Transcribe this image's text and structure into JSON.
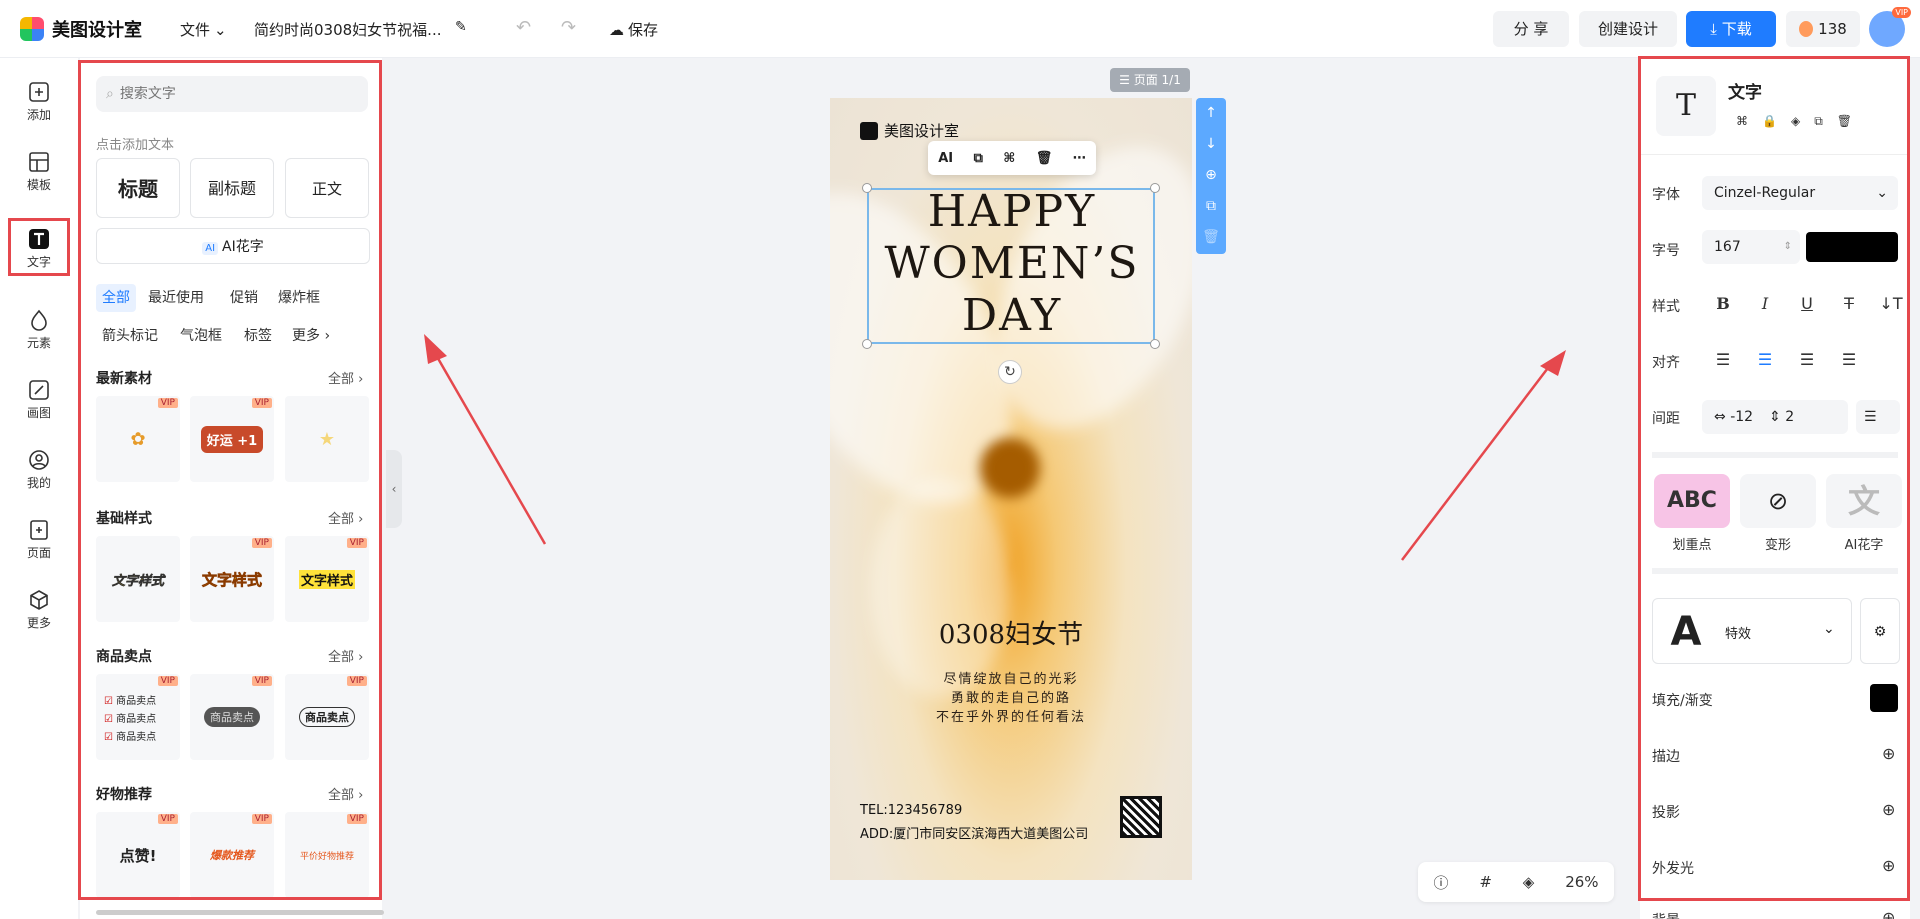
{
  "topbar": {
    "app_name": "美图设计室",
    "menu_file": "文件",
    "doc_title": "简约时尚0308妇女节祝福...",
    "save": "保存",
    "share": "分 享",
    "create": "创建设计",
    "download": "下载",
    "coins": "138",
    "vip": "VIP"
  },
  "rail": {
    "items": [
      {
        "label": "添加",
        "icon": "plus-square-icon"
      },
      {
        "label": "模板",
        "icon": "template-icon"
      },
      {
        "label": "文字",
        "icon": "text-icon"
      },
      {
        "label": "元素",
        "icon": "shapes-icon"
      },
      {
        "label": "画图",
        "icon": "draw-icon"
      },
      {
        "label": "我的",
        "icon": "user-icon"
      },
      {
        "label": "页面",
        "icon": "page-add-icon"
      },
      {
        "label": "更多",
        "icon": "cube-icon"
      }
    ],
    "active": "文字"
  },
  "panel": {
    "search_placeholder": "搜索文字",
    "hint": "点击添加文本",
    "btn_title": "标题",
    "btn_subtitle": "副标题",
    "btn_body": "正文",
    "ai_badge": "AI",
    "ai_btn": "AI花字",
    "tags": [
      "全部",
      "最近使用",
      "促销",
      "爆炸框",
      "箭头标记",
      "气泡框",
      "标签",
      "更多"
    ],
    "all_label": "全部",
    "sections": [
      {
        "title": "最新素材",
        "cards": [
          {
            "text": "",
            "vip": true
          },
          {
            "text": "好运 +1",
            "vip": true
          },
          {
            "text": "",
            "vip": false
          }
        ]
      },
      {
        "title": "基础样式",
        "cards": [
          {
            "text": "文字样式",
            "vip": false
          },
          {
            "text": "文字样式",
            "vip": true
          },
          {
            "text": "文字样式",
            "vip": true
          }
        ]
      },
      {
        "title": "商品卖点",
        "cards": [
          {
            "text": "商品卖点",
            "vip": true
          },
          {
            "text": "商品卖点",
            "vip": true
          },
          {
            "text": "商品卖点",
            "vip": true
          }
        ]
      },
      {
        "title": "好物推荐",
        "cards": [
          {
            "text": "点赞!",
            "vip": true
          },
          {
            "text": "爆款推荐",
            "vip": true
          },
          {
            "text": "平价好物推荐",
            "vip": true
          }
        ]
      }
    ],
    "vip_label": "VIP"
  },
  "canvas": {
    "page_label": "页面 1/1",
    "brand": "美图设计室",
    "headline": [
      "HAPPY",
      "WOMEN’S",
      "DAY"
    ],
    "title": "0308妇女节",
    "lines": [
      "尽情绽放自己的光彩",
      "勇敢的走自己的路",
      "不在乎外界的任何看法"
    ],
    "tel": "TEL:123456789",
    "addr": "ADD:厦门市同安区滨海西大道美图公司",
    "floatbar_ai": "AI"
  },
  "bottom": {
    "zoom": "26%"
  },
  "right": {
    "header": "文字",
    "font_label": "字体",
    "font_value": "Cinzel-Regular",
    "size_label": "字号",
    "size_value": "167",
    "style_label": "样式",
    "align_label": "对齐",
    "spacing_label": "间距",
    "letter_spacing": "-12",
    "line_spacing": "2",
    "fx": [
      "划重点",
      "变形",
      "AI花字"
    ],
    "fx_abc": "ABC",
    "fx_wen": "文",
    "effect_label": "特效",
    "effect_glyph": "A",
    "fill_label": "填充/渐变",
    "stroke_label": "描边",
    "shadow_label": "投影",
    "glow_label": "外发光",
    "bg_label": "背景",
    "text_color": "#000000"
  },
  "colors": {
    "accent": "#1f7cff",
    "highlight": "#e5484d"
  }
}
